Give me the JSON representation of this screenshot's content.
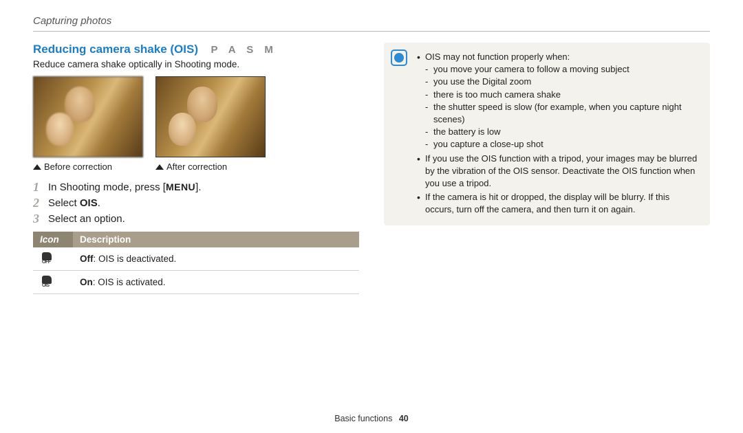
{
  "header": {
    "breadcrumb": "Capturing photos"
  },
  "section": {
    "title": "Reducing camera shake (OIS)",
    "modes": "P  A  S  M",
    "intro": "Reduce camera shake optically in Shooting mode.",
    "captions": {
      "before": "Before correction",
      "after": "After correction"
    }
  },
  "steps": {
    "s1_a": "In Shooting mode, press [",
    "s1_key": "MENU",
    "s1_b": "].",
    "s2_a": "Select ",
    "s2_bold": "OIS",
    "s2_b": ".",
    "s3": "Select an option."
  },
  "table": {
    "head_icon": "Icon",
    "head_desc": "Description",
    "rows": [
      {
        "icon_sub": "OFF",
        "bold": "Off",
        "rest": ": OIS is deactivated."
      },
      {
        "icon_sub": "OIS",
        "bold": "On",
        "rest": ": OIS is activated."
      }
    ]
  },
  "note": {
    "b1": "OIS may not function properly when:",
    "b1_subs": [
      "you move your camera to follow a moving subject",
      "you use the Digital zoom",
      "there is too much camera shake",
      "the shutter speed is slow (for example, when you capture night scenes)",
      "the battery is low",
      "you capture a close-up shot"
    ],
    "b2": "If you use the OIS function with a tripod, your images may be blurred by the vibration of the OIS sensor. Deactivate the OIS function when you use a tripod.",
    "b3": "If the camera is hit or dropped, the display will be blurry. If this occurs, turn off the camera, and then turn it on again."
  },
  "footer": {
    "section": "Basic functions",
    "page": "40"
  }
}
